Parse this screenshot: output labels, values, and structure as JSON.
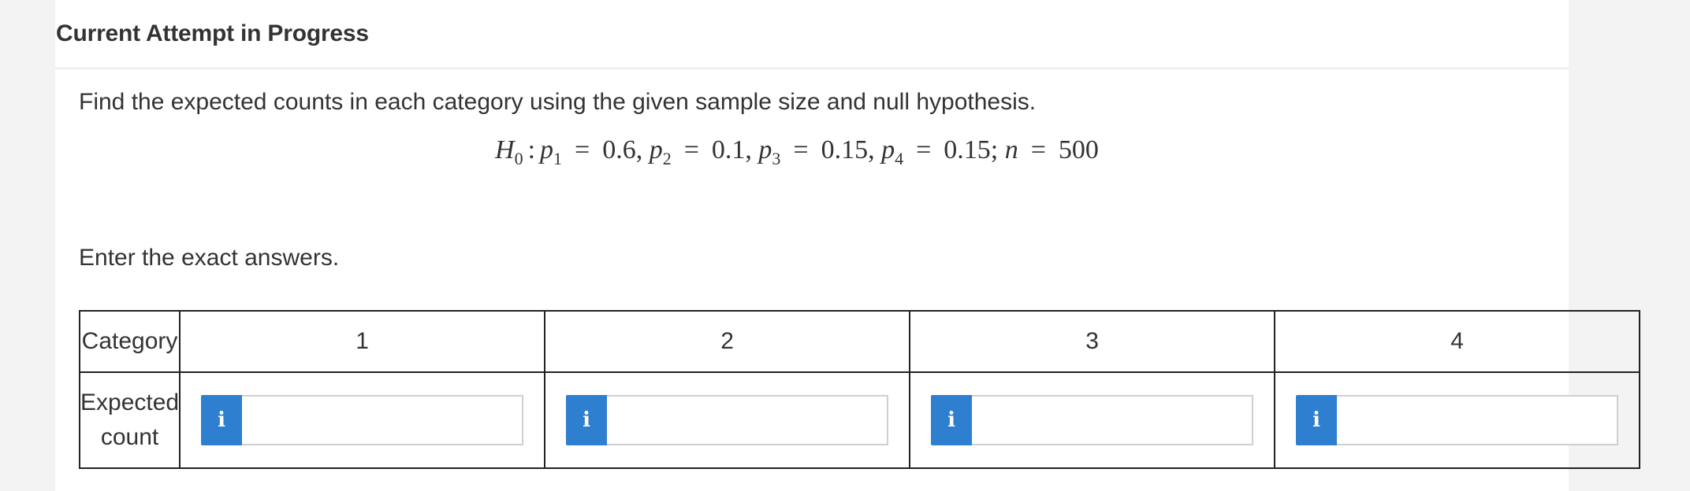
{
  "header": {
    "title": "Current Attempt in Progress"
  },
  "question": {
    "prompt": "Find the expected counts in each category using the given sample size and null hypothesis.",
    "equation": {
      "H": "H",
      "H_sub": "0",
      "colon": ":",
      "p1": "p",
      "p1_sub": "1",
      "p1_val": "0.6,",
      "p2": "p",
      "p2_sub": "2",
      "p2_val": "0.1,",
      "p3": "p",
      "p3_sub": "3",
      "p3_val": "0.15,",
      "p4": "p",
      "p4_sub": "4",
      "p4_val": "0.15;",
      "n": "n",
      "n_val": "500",
      "eq": "="
    },
    "instruction": "Enter the exact answers."
  },
  "table": {
    "header_label": "Category",
    "categories": [
      "1",
      "2",
      "3",
      "4"
    ],
    "row_label_line1": "Expected",
    "row_label_line2": "count",
    "info_icon_glyph": "i",
    "values": [
      "",
      "",
      "",
      ""
    ]
  },
  "colors": {
    "info_button": "#2f7fd1",
    "border": "#222222"
  }
}
